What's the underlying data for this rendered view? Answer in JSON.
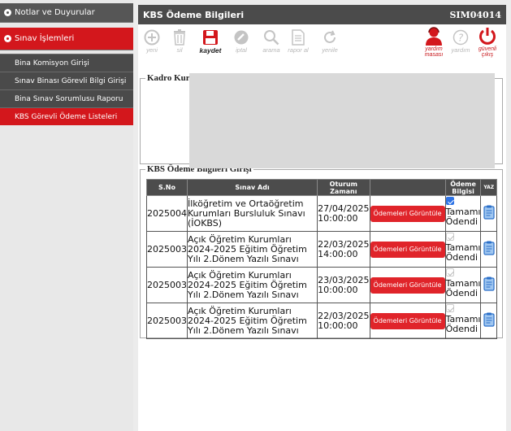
{
  "sidebar": {
    "section1": "Notlar ve Duyurular",
    "section2": "Sınav İşlemleri",
    "items": [
      {
        "label": "Bina Komisyon Girişi"
      },
      {
        "label": "Sınav Binası Görevli Bilgi Girişi"
      },
      {
        "label": "Bina Sınav Sorumlusu Raporu"
      },
      {
        "label": "KBS Görevli Ödeme Listeleri"
      }
    ]
  },
  "header": {
    "title": "KBS Ödeme Bilgileri",
    "code": "SIM04014"
  },
  "toolbar": {
    "yeni": "yeni",
    "sil": "sil",
    "kaydet": "kaydet",
    "iptal": "iptal",
    "arama": "arama",
    "rapor_al": "rapor al",
    "yenile": "yenile",
    "yardim_masasi_1": "yardım",
    "yardim_masasi_2": "masası",
    "yardim": "yardım",
    "guvenli_1": "güvenli",
    "guvenli_2": "çıkış"
  },
  "kadro": {
    "legend": "Kadro Kurum Bilgileri"
  },
  "kbs": {
    "legend": "KBS Ödeme Bilgileri Girişi",
    "columns": {
      "sno": "S.No",
      "sinav": "Sınav Adı",
      "oturum_1": "Oturum",
      "oturum_2": "Zamanı",
      "odeme_1": "Ödeme",
      "odeme_2": "Bilgisi",
      "yaz": "YAZ"
    },
    "rows": [
      {
        "sno": "2025004",
        "sinav": "İlköğretim ve Ortaöğretim Kurumları Bursluluk Sınavı (İOKBS)",
        "date": "27/04/2025",
        "time": "10:00:00",
        "button": "Ödemeleri Görüntüle",
        "checked": true,
        "status": "Tamamı Ödendi"
      },
      {
        "sno": "2025003",
        "sinav": "Açık Öğretim Kurumları 2024-2025 Eğitim Öğretim Yılı 2.Dönem Yazılı Sınavı",
        "date": "22/03/2025",
        "time": "14:00:00",
        "button": "Ödemeleri Görüntüle",
        "checked": false,
        "status": "Tamamı Ödendi"
      },
      {
        "sno": "2025003",
        "sinav": "Açık Öğretim Kurumları 2024-2025 Eğitim Öğretim Yılı 2.Dönem Yazılı Sınavı",
        "date": "23/03/2025",
        "time": "10:00:00",
        "button": "Ödemeleri Görüntüle",
        "checked": false,
        "status": "Tamamı Ödendi"
      },
      {
        "sno": "2025003",
        "sinav": "Açık Öğretim Kurumları 2024-2025 Eğitim Öğretim Yılı 2.Dönem Yazılı Sınavı",
        "date": "22/03/2025",
        "time": "10:00:00",
        "button": "Ödemeleri Görüntüle",
        "checked": false,
        "status": "Tamamı Ödendi"
      }
    ]
  },
  "colors": {
    "accent_red": "#d3171c",
    "header_dark": "#4b4b4b",
    "check_blue": "#2d73e6"
  }
}
